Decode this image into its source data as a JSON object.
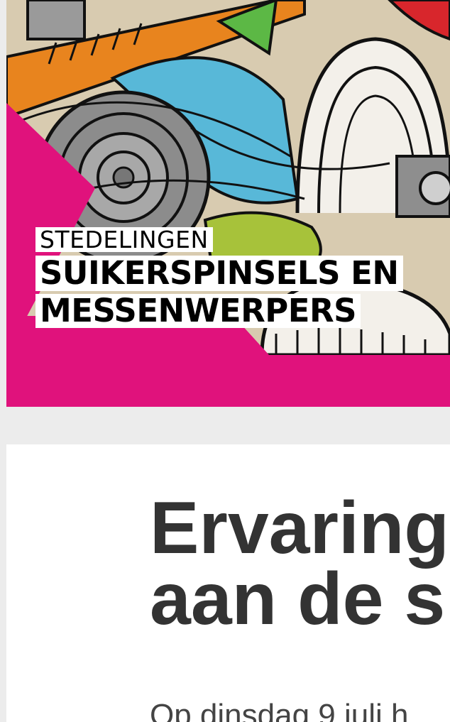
{
  "hero": {
    "subtitle": "STEDELINGEN",
    "title_line1": "SUIKERSPINSELS EN",
    "title_line2": "MESSENWERPERS",
    "accent_color": "#e0127c"
  },
  "article": {
    "headline_line1": "Ervaring",
    "headline_line2": "aan de s",
    "intro": "Op dinsdag 9 juli h"
  }
}
